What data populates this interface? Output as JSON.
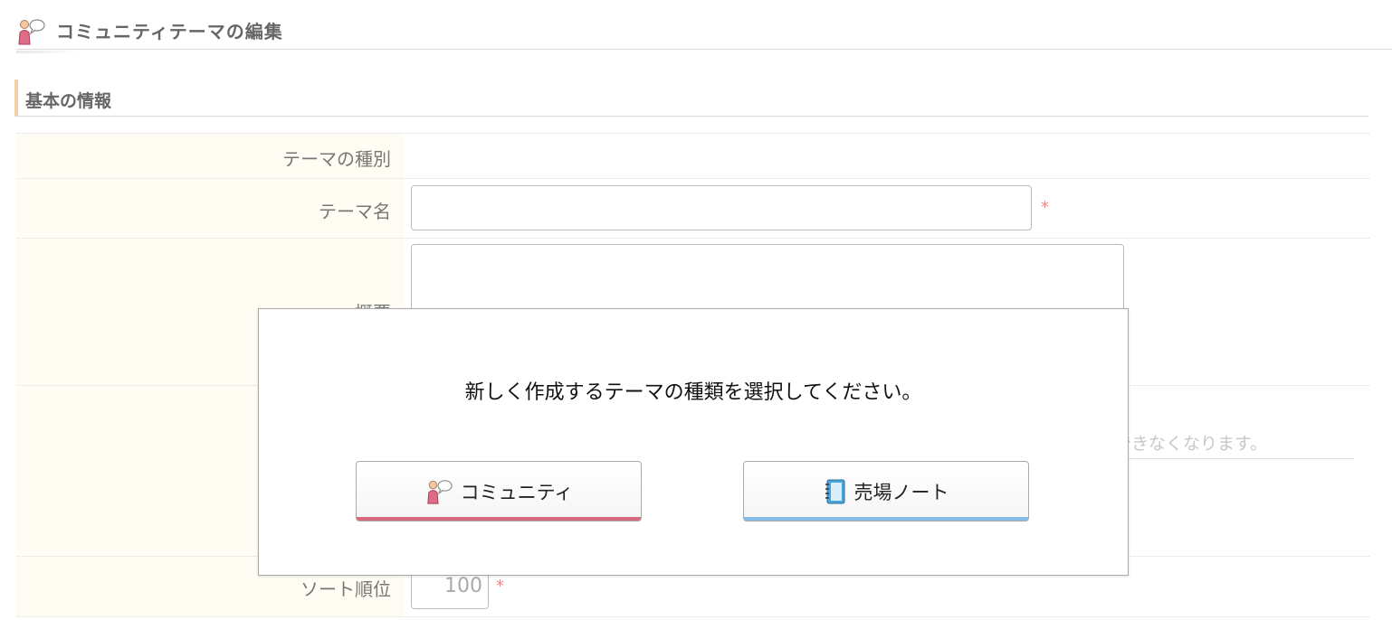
{
  "header": {
    "title": "コミュニティテーマの編集",
    "icon": "community-icon"
  },
  "section": {
    "title": "基本の情報"
  },
  "form": {
    "theme_type_label": "テーマの種別",
    "theme_name_label": "テーマ名",
    "theme_name_value": "",
    "summary_label": "概要",
    "summary_value": "",
    "hint_fragment": "はできなくなります。",
    "sort_label": "ソート順位",
    "sort_value": "100",
    "required_mark": "*"
  },
  "modal": {
    "message": "新しく作成するテーマの種類を選択してください。",
    "buttons": [
      {
        "label": "コミュニティ",
        "icon": "community-icon",
        "accent": "#d9697f"
      },
      {
        "label": "売場ノート",
        "icon": "notebook-icon",
        "accent": "#86bde7"
      }
    ]
  },
  "colors": {
    "label_background": "#fffdf3",
    "section_accent": "#f2d3a8",
    "required": "#ee8a8a"
  }
}
